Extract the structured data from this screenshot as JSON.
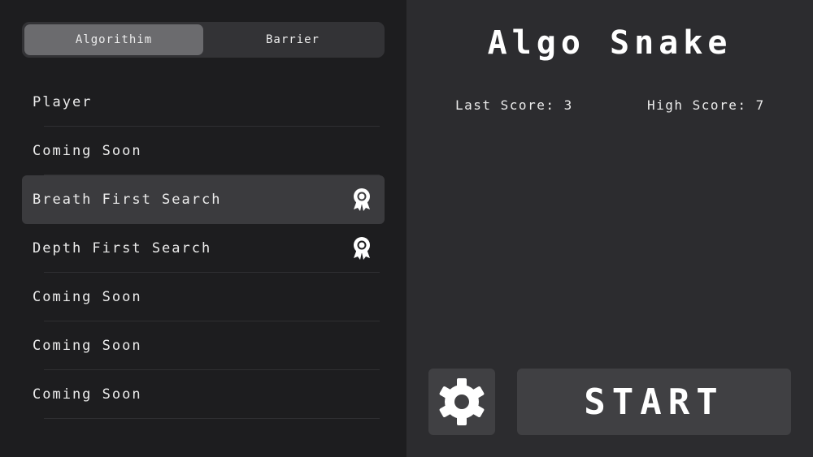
{
  "tabs": [
    {
      "label": "Algorithim",
      "active": true
    },
    {
      "label": "Barrier",
      "active": false
    }
  ],
  "list": [
    {
      "label": "Player",
      "badge": false
    },
    {
      "label": "Coming Soon",
      "badge": false
    },
    {
      "label": "Breath First Search",
      "badge": true,
      "selected": true
    },
    {
      "label": "Depth First Search",
      "badge": true
    },
    {
      "label": "Coming Soon",
      "badge": false
    },
    {
      "label": "Coming Soon",
      "badge": false
    },
    {
      "label": "Coming Soon",
      "badge": false
    }
  ],
  "title": "Algo Snake",
  "scores": {
    "last": "Last Score: 3",
    "high": "High Score: 7"
  },
  "settings_icon": "gear-icon",
  "badge_icon": "award-ribbon-icon",
  "start_label": "START",
  "colors": {
    "sidebar_bg": "#1d1d1f",
    "main_bg": "#2c2c2f",
    "selected_row": "#3b3b3e",
    "active_tab": "#6b6b6e",
    "button_bg": "#404043"
  }
}
